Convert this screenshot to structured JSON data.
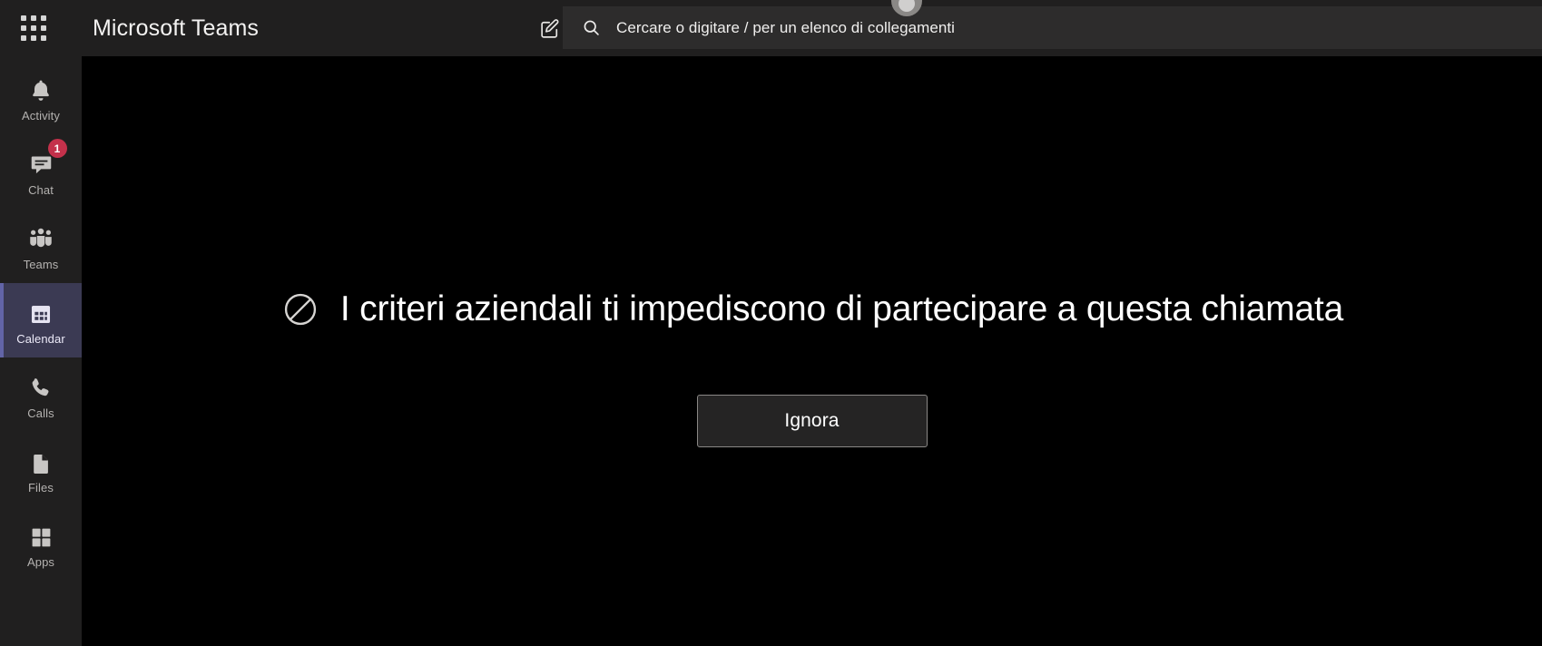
{
  "app": {
    "title": "Microsoft Teams",
    "theme": "dark",
    "accent_color": "#6264a7",
    "badge_color": "#c4314b",
    "content_background": "#000000",
    "chrome_background": "#201f1f"
  },
  "topbar": {
    "waffle_icon": "app-grid-icon",
    "compose_icon": "compose-new-chat-icon",
    "avatar": "user-avatar",
    "search": {
      "icon": "search-icon",
      "placeholder": "Cercare o digitare / per un elenco di collegamenti",
      "value": ""
    }
  },
  "sidebar": {
    "items": [
      {
        "label": "Activity",
        "icon": "bell-icon",
        "active": false,
        "badge": ""
      },
      {
        "label": "Chat",
        "icon": "chat-bubble-icon",
        "active": false,
        "badge": "1"
      },
      {
        "label": "Teams",
        "icon": "people-group-icon",
        "active": false,
        "badge": ""
      },
      {
        "label": "Calendar",
        "icon": "calendar-icon",
        "active": true,
        "badge": ""
      },
      {
        "label": "Calls",
        "icon": "phone-icon",
        "active": false,
        "badge": ""
      },
      {
        "label": "Files",
        "icon": "file-icon",
        "active": false,
        "badge": ""
      },
      {
        "label": "Apps",
        "icon": "apps-grid-icon",
        "active": false,
        "badge": ""
      }
    ]
  },
  "main": {
    "notice": {
      "icon": "blocked-circle-slash-icon",
      "message": "I criteri aziendali ti impediscono di partecipare a questa chiamata"
    },
    "dismiss_button_label": "Ignora"
  }
}
